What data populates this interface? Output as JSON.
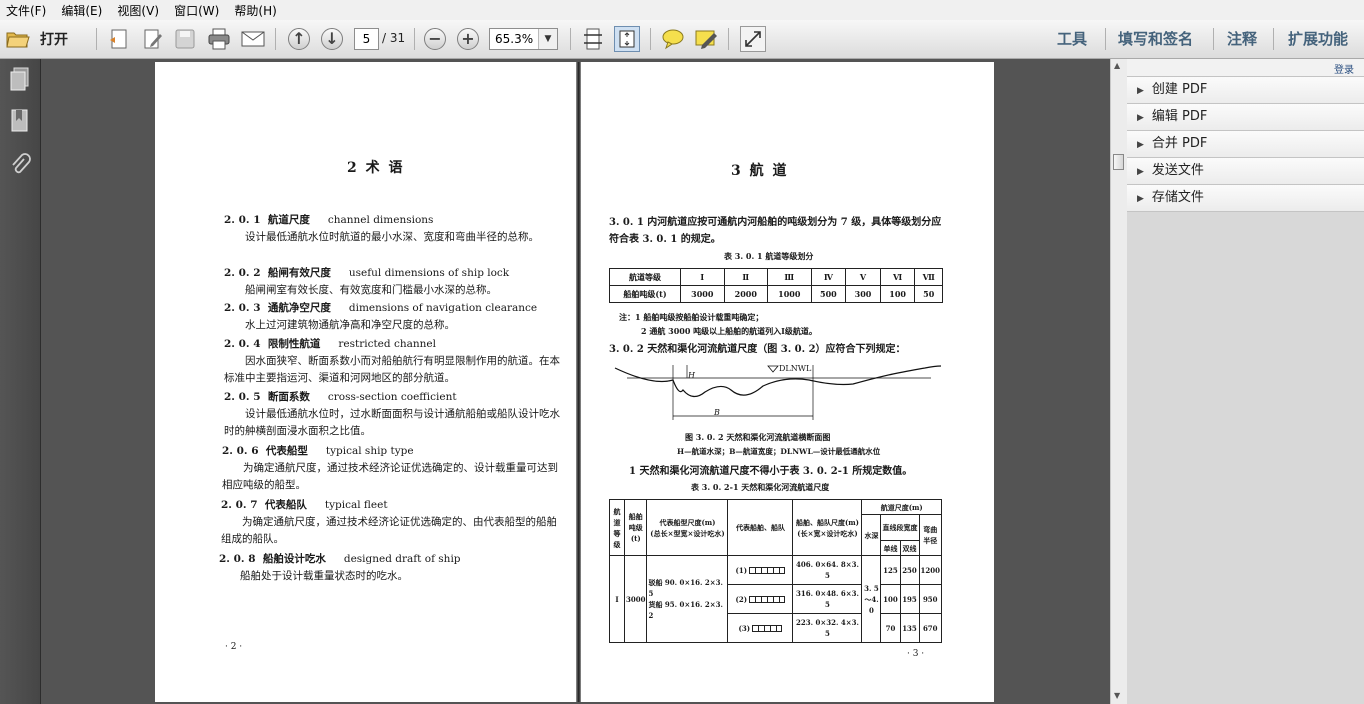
{
  "menu": [
    "文件(F)",
    "编辑(E)",
    "视图(V)",
    "窗口(W)",
    "帮助(H)"
  ],
  "toolbar": {
    "open_label": "打开",
    "page_current": "5",
    "page_total": "/ 31",
    "zoom": "65.3%",
    "right_links": [
      "工具",
      "填写和签名",
      "注释",
      "扩展功能"
    ]
  },
  "right_panel": {
    "login": "登录",
    "items": [
      "创建 PDF",
      "编辑 PDF",
      "合并 PDF",
      "发送文件",
      "存储文件"
    ]
  },
  "left_page": {
    "title": "2  术    语",
    "entries": [
      {
        "num": "2. 0. 1",
        "term": "航道尺度",
        "en": "channel dimensions",
        "desc": "设计最低通航水位时航道的最小水深、宽度和弯曲半径的总称。"
      },
      {
        "num": "2. 0. 2",
        "term": "船闸有效尺度",
        "en": "useful dimensions of ship lock",
        "desc": "船闸闸室有效长度、有效宽度和门槛最小水深的总称。"
      },
      {
        "num": "2. 0. 3",
        "term": "通航净空尺度",
        "en": "dimensions of navigation clearance",
        "desc": "水上过河建筑物通航净高和净空尺度的总称。"
      },
      {
        "num": "2. 0. 4",
        "term": "限制性航道",
        "en": "restricted channel",
        "desc": "因水面狭窄、断面系数小而对船舶航行有明显限制作用的航道。在本标准中主要指运河、渠道和河网地区的部分航道。"
      },
      {
        "num": "2. 0. 5",
        "term": "断面系数",
        "en": "cross-section coefficient",
        "desc": "设计最低通航水位时，过水断面面积与设计通航船舶或船队设计吃水时的舯横剖面浸水面积之比值。"
      },
      {
        "num": "2. 0. 6",
        "term": "代表船型",
        "en": "typical ship type",
        "desc": "为确定通航尺度，通过技术经济论证优选确定的、设计载重量可达到相应吨级的船型。"
      },
      {
        "num": "2. 0. 7",
        "term": "代表船队",
        "en": "typical fleet",
        "desc": "为确定通航尺度，通过技术经济论证优选确定的、由代表船型的船舶组成的船队。"
      },
      {
        "num": "2. 0. 8",
        "term": "船舶设计吃水",
        "en": "designed draft of ship",
        "desc": "船舶处于设计载重量状态时的吃水。"
      }
    ],
    "page_no": "· 2 ·"
  },
  "right_page": {
    "title": "3  航    道",
    "p301": "3. 0. 1   内河航道应按可通航内河船舶的吨级划分为 7 级，具体等级划分应符合表 3. 0. 1 的规定。",
    "table1_caption": "表 3. 0. 1   航道等级划分",
    "table1": {
      "row1_label": "航道等级",
      "levels": [
        "Ⅰ",
        "Ⅱ",
        "Ⅲ",
        "Ⅳ",
        "Ⅴ",
        "Ⅵ",
        "Ⅶ"
      ],
      "row2_label": "船舶吨级(t)",
      "tonnage": [
        "3000",
        "2000",
        "1000",
        "500",
        "300",
        "100",
        "50"
      ]
    },
    "note1": "注：1  船舶吨级按船舶设计载重吨确定；",
    "note2": "2  通航 3000 吨级以上船舶的航道列入Ⅰ级航道。",
    "p302": "3. 0. 2   天然和渠化河流航道尺度（图 3. 0. 2）应符合下列规定：",
    "fig_label_dlnwl": "DLNWL",
    "fig_label_h": "H",
    "fig_label_b": "B",
    "fig_caption": "图 3. 0. 2   天然和渠化河流航道横断面图",
    "fig_legend": "H—航道水深；B—航道宽度；DLNWL—设计最低通航水位",
    "item1": "1   天然和渠化河流航道尺度不得小于表 3. 0. 2-1 所规定数值。",
    "table2_caption": "表 3. 0. 2-1   天然和渠化河流航道尺度",
    "table2": {
      "h_level": "航道等级",
      "h_tonnage": "船舶吨级(t)",
      "h_ship": "代表船型尺度(m)",
      "h_ship_sub": "(总长×型宽×设计吃水)",
      "h_fleet": "代表船舶、船队",
      "h_fleet_size": "船舶、船队尺度(m)",
      "h_fleet_size_sub": "(长×宽×设计吃水)",
      "h_dims": "航道尺度(m)",
      "h_depth": "水深",
      "h_width": "直线段宽度",
      "h_single": "单线",
      "h_double": "双线",
      "h_radius": "弯曲半径",
      "level": "Ⅰ",
      "tonnage": "3000",
      "ship1": "驳船 90. 0×16. 2×3. 5",
      "ship2": "货船 95. 0×16. 2×3. 2",
      "depth": "3. 5～4. 0",
      "rows": [
        {
          "fleet": "(1)",
          "size": "406. 0×64. 8×3. 5",
          "single": "125",
          "double": "250",
          "radius": "1200"
        },
        {
          "fleet": "(2)",
          "size": "316. 0×48. 6×3. 5",
          "single": "100",
          "double": "195",
          "radius": "950"
        },
        {
          "fleet": "(3)",
          "size": "223. 0×32. 4×3. 5",
          "single": "70",
          "double": "135",
          "radius": "670"
        }
      ]
    },
    "page_no": "· 3 ·"
  }
}
